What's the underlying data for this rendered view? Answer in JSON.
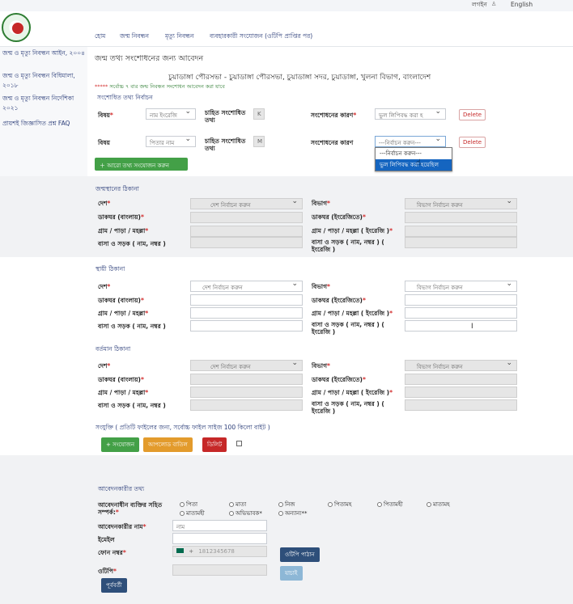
{
  "topbar": {
    "login": "লগইন",
    "english": "English"
  },
  "nav": [
    "হোম",
    "জন্ম নিবন্ধন",
    "মৃত্যু নিবন্ধন",
    "ব্যবহারকারী সংযোজন (ওটিপি প্রাপ্তির পর)"
  ],
  "sidebar": {
    "items": [
      "জন্ম ও মৃত্যু নিবন্ধন আইন, ২০০৪",
      "জন্ম ও মৃত্যু নিবন্ধন বিধিমালা, ২০১৮",
      "জন্ম ও মৃত্যু নিবন্ধন নির্দেশিকা ২০২১",
      "প্রায়শই জিজ্ঞাসিত প্রশ্ন FAQ"
    ]
  },
  "page": {
    "title": "জন্ম তথ্য সংশোধনের জন্য আবেদন",
    "office": "চুয়াডাঙ্গা পৌরসভা - চুয়াডাঙ্গা পৌরসভা, চুয়াডাঙ্গা সদর, চুয়াডাঙ্গা, খুলনা বিভাগ, বাংলাদেশ",
    "warning": "সর্বোচ্চ ৭ বার জন্ম নিবন্ধন সংশোধন আবেদন করা যাবে",
    "section_select": "সংশোধিত তথ্য নির্বাচন"
  },
  "correction": {
    "row1": {
      "subject_label": "বিষয়",
      "subject_value": "নাম ইংরেজি",
      "desired_label": "চাহিত সংশোধিত তথ্য",
      "desired_value": "K",
      "reason_label": "সংশোধনের কারণ",
      "reason_value": "ভুল লিপিবদ্ধ করা হ",
      "delete": "Delete"
    },
    "row2": {
      "subject_label": "বিষয়",
      "subject_value": "পিতার নাম",
      "desired_label": "চাহিত সংশোধিত তথ্য",
      "desired_value": "M",
      "reason_label": "সংশোধনের কারণ",
      "reason_value": "---নির্বাচন করুন---",
      "delete": "Delete"
    },
    "dropdown_options": [
      "---নির্বাচন করুন---",
      "ভুল লিপিবদ্ধ করা হয়েছিল"
    ],
    "add_button": "আরো তথ্য সংযোজন করুন"
  },
  "birth_place": {
    "heading": "জন্মস্থানের ঠিকানা",
    "country_label": "দেশ",
    "country_value": "দেশ নির্বাচন করুন",
    "division_label": "বিভাগ",
    "division_value": "বিভাগ নির্বাচন করুন",
    "postbn_label": "ডাকঘর (বাংলায়)",
    "posten_label": "ডাকঘর (ইংরেজিতে)",
    "villagebn_label": "গ্রাম / পাড়া / মহল্লা",
    "villageen_label": "গ্রাম / পাড়া / মহল্লা ( ইংরেজি )",
    "housebn_label": "বাসা ও সড়ক ( নাম, নম্বর )",
    "houseen_label": "বাসা ও সড়ক ( নাম, নম্বর ) ( ইংরেজি )"
  },
  "permanent": {
    "heading": "স্থায়ী ঠিকানা",
    "country_label": "দেশ",
    "country_value": "দেশ নির্বাচন করুন",
    "division_label": "বিভাগ",
    "division_value": "বিভাগ নির্বাচন করুন",
    "postbn_label": "ডাকঘর (বাংলায়)",
    "posten_label": "ডাকঘর (ইংরেজিতে)",
    "villagebn_label": "গ্রাম / পাড়া / মহল্লা",
    "villageen_label": "গ্রাম / পাড়া / মহল্লা ( ইংরেজি )",
    "housebn_label": "বাসা ও সড়ক ( নাম, নম্বর )",
    "houseen_label": "বাসা ও সড়ক ( নাম, নম্বর ) ( ইংরেজি )"
  },
  "present": {
    "heading": "বর্তমান ঠিকানা",
    "country_label": "দেশ",
    "country_value": "দেশ নির্বাচন করুন",
    "division_label": "বিভাগ",
    "division_value": "বিভাগ নির্বাচন করুন",
    "postbn_label": "ডাকঘর (বাংলায়)",
    "posten_label": "ডাকঘর (ইংরেজিতে)",
    "villagebn_label": "গ্রাম / পাড়া / মহল্লা",
    "villageen_label": "গ্রাম / পাড়া / মহল্লা ( ইংরেজি )",
    "housebn_label": "বাসা ও সড়ক ( নাম, নম্বর )",
    "houseen_label": "বাসা ও সড়ক ( নাম, নম্বর ) ( ইংরেজি )"
  },
  "attachment": {
    "heading": "সংযুক্তি ( প্রতিটি ফাইলের জন্য, সর্বোচ্চ ফাইল সাইজ 100 কিলো বাইট )",
    "add": "+ সংযোজন",
    "upload": "আপলোড বাতিল",
    "delete": "ডিলিট"
  },
  "applicant": {
    "heading": "আবেদনকারীর তথ্য",
    "relation_label": "আবেদনাধীন ব্যক্তির সহিত সম্পর্ক:",
    "options_row1": [
      "পিতা",
      "মাতা",
      "নিজ",
      "পিতামহ",
      "পিতামহী",
      "মাতামহ"
    ],
    "options_row2": [
      "মাতামহী",
      "অভিভাবক*",
      "অন্যান্য**"
    ],
    "name_label": "আবেদনকারীর নাম",
    "name_placeholder": "নাম",
    "email_label": "ইমেইল",
    "phone_label": "ফোন নম্বর",
    "phone_prefix": "+",
    "phone_placeholder": "1812345678",
    "otp_send": "ওটিপি পাঠান",
    "otp_label": "ওটিপি",
    "verify": "যাচাই",
    "prev": "পূর্ববর্তী"
  }
}
